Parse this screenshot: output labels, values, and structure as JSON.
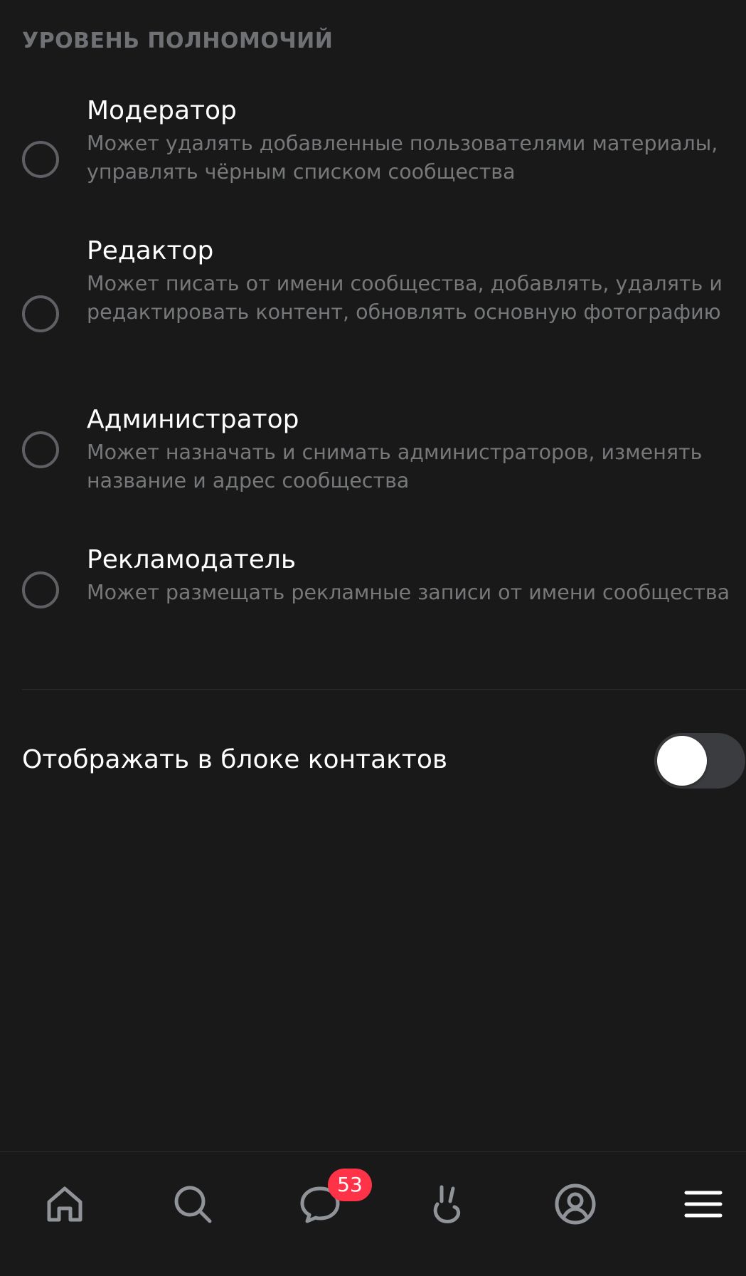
{
  "section": {
    "title": "УРОВЕНЬ ПОЛНОМОЧИЙ"
  },
  "roles": [
    {
      "title": "Модератор",
      "description": "Может удалять добавленные пользователями материалы, управлять чёрным списком сообщества",
      "selected": false
    },
    {
      "title": "Редактор",
      "description": "Может писать от имени сообщества, добавлять, удалять и редактировать контент, обновлять основную фотографию",
      "selected": false
    },
    {
      "title": "Администратор",
      "description": "Может назначать и снимать администраторов, изменять название и адрес сообщества",
      "selected": false
    },
    {
      "title": "Рекламодатель",
      "description": "Может размещать рекламные записи от имени сообщества",
      "selected": false
    }
  ],
  "contacts": {
    "label": "Отображать в блоке контактов",
    "enabled": false
  },
  "tabbar": {
    "items": [
      {
        "icon": "home-icon"
      },
      {
        "icon": "search-icon"
      },
      {
        "icon": "messages-icon",
        "badge": "53"
      },
      {
        "icon": "clips-icon"
      },
      {
        "icon": "profile-icon"
      },
      {
        "icon": "menu-icon"
      }
    ]
  },
  "colors": {
    "background": "#19191a",
    "secondary_text": "#76787a",
    "badge": "#ff3347",
    "toggle_off": "#3b3c3f"
  }
}
